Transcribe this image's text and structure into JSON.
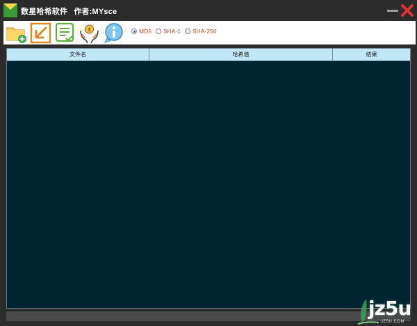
{
  "window": {
    "app_name": "数星哈希软件",
    "author_label": "作者:MYsce"
  },
  "toolbar": {
    "buttons": [
      {
        "icon": "add-folder-icon",
        "name": "add-files"
      },
      {
        "icon": "export-icon",
        "name": "export"
      },
      {
        "icon": "document-check-icon",
        "name": "report"
      },
      {
        "icon": "donate-hands-icon",
        "name": "donate"
      },
      {
        "icon": "info-bubble-icon",
        "name": "about"
      }
    ],
    "hash_options": [
      {
        "label": "MD5",
        "checked": true
      },
      {
        "label": "SHA-1",
        "checked": false
      },
      {
        "label": "SHA-256",
        "checked": false
      }
    ]
  },
  "table": {
    "columns": [
      "文件名",
      "哈希值",
      "结果"
    ],
    "rows": []
  },
  "watermark": {
    "text": "jz5u",
    "sub": "JZ5U.COM"
  },
  "colors": {
    "titlebar": "#2b2b2b",
    "table_bg": "#002530",
    "header_bg": "#bfe7f7",
    "radio_text": "#c0502a",
    "close_red": "#e03030"
  }
}
